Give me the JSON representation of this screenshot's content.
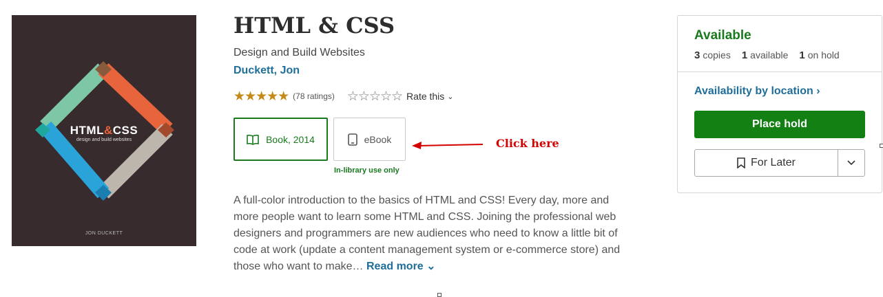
{
  "cover": {
    "title_part1": "HTML",
    "title_amp": "&",
    "title_part2": "CSS",
    "subtitle": "design and build websites",
    "author": "JON DUCKETT"
  },
  "book": {
    "title": "HTML & CSS",
    "subtitle": "Design and Build Websites",
    "author": "Duckett, Jon",
    "rating_stars": "★★★★★",
    "rating_count": "(78 ratings)",
    "rate_stars": "☆☆☆☆☆",
    "rate_label": "Rate this"
  },
  "formats": {
    "book_label": "Book, 2014",
    "ebook_label": "eBook",
    "ebook_note": "In-library use only"
  },
  "annotation": {
    "text": "Click here",
    "color": "#d40000"
  },
  "description": {
    "text": "A full-color introduction to the basics of HTML and CSS! Every day, more and more people want to learn some HTML and CSS. Joining the professional web designers and programmers are new audiences who need to know a little bit of code at work (update a content management system or e-commerce store) and those who want to make…",
    "read_more": "Read more"
  },
  "availability": {
    "status": "Available",
    "copies_count": "3",
    "copies_label": "copies",
    "available_count": "1",
    "available_label": "available",
    "hold_count": "1",
    "hold_label": "on hold",
    "by_location": "Availability by location",
    "place_hold": "Place hold",
    "for_later": "For Later"
  },
  "colors": {
    "accent_green": "#187a1c",
    "link_blue": "#1f6e99",
    "star_gold": "#c48a16"
  }
}
